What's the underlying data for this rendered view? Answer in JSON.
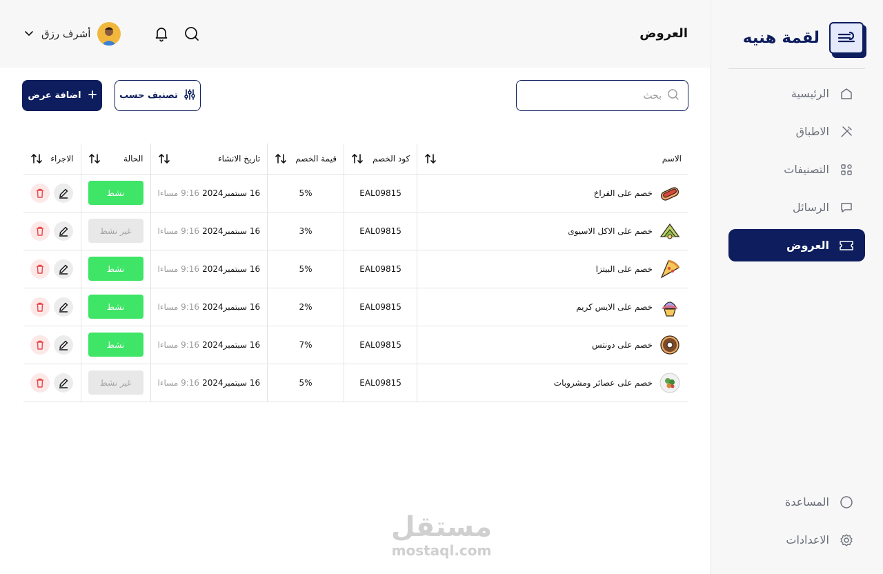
{
  "brand": {
    "name": "لقمة هنيه"
  },
  "sidebar": {
    "items": [
      {
        "label": "الرئيسية",
        "icon": "home-icon",
        "active": false
      },
      {
        "label": "الاطباق",
        "icon": "dishes-icon",
        "active": false
      },
      {
        "label": "التصنيفات",
        "icon": "categories-icon",
        "active": false
      },
      {
        "label": "الرسائل",
        "icon": "messages-icon",
        "active": false
      },
      {
        "label": "العروض",
        "icon": "offers-icon",
        "active": true
      }
    ],
    "bottom": [
      {
        "label": "المساعدة",
        "icon": "help-icon"
      },
      {
        "label": "الاعدادات",
        "icon": "settings-icon"
      }
    ]
  },
  "header": {
    "title": "العروض",
    "user_name": "أشرف رزق"
  },
  "toolbar": {
    "search_placeholder": "بحث",
    "sort_label": "تصنيف حسب",
    "add_label": "اضافة عرض"
  },
  "table": {
    "columns": {
      "name": "الاسم",
      "code": "كود الخصم",
      "discount": "قيمة الخصم",
      "date": "تاريخ الانشاء",
      "status": "الحالة",
      "actions": "الاجراء"
    },
    "rows": [
      {
        "name": "خصم على الفراخ",
        "code": "EAL09815",
        "discount": "5%",
        "date": "16 سبتمبر2024",
        "time": "9:16 مساءا",
        "status": "نشط",
        "active": true,
        "icon": "hotdog-icon"
      },
      {
        "name": "خصم على الاكل الاسيوى",
        "code": "EAL09815",
        "discount": "3%",
        "date": "16 سبتمبر2024",
        "time": "9:16 مساءا",
        "status": "غير نشط",
        "active": false,
        "icon": "dumpling-icon"
      },
      {
        "name": "خصم على البيتزا",
        "code": "EAL09815",
        "discount": "5%",
        "date": "16 سبتمبر2024",
        "time": "9:16 مساءا",
        "status": "نشط",
        "active": true,
        "icon": "pizza-icon"
      },
      {
        "name": "خصم على الايس كريم",
        "code": "EAL09815",
        "discount": "2%",
        "date": "16 سبتمبر2024",
        "time": "9:16 مساءا",
        "status": "نشط",
        "active": true,
        "icon": "icecream-icon"
      },
      {
        "name": "خصم على دونتس",
        "code": "EAL09815",
        "discount": "7%",
        "date": "16 سبتمبر2024",
        "time": "9:16 مساءا",
        "status": "نشط",
        "active": true,
        "icon": "donut-icon"
      },
      {
        "name": "خصم على عصائر ومشروبات",
        "code": "EAL09815",
        "discount": "5%",
        "date": "16 سبتمبر2024",
        "time": "9:16 مساءا",
        "status": "غير نشط",
        "active": false,
        "icon": "salad-icon"
      }
    ]
  },
  "watermark": {
    "arabic": "مستقل",
    "latin": "mostaql.com"
  },
  "colors": {
    "primary": "#0d1d5e",
    "active": "#3ee566",
    "inactive": "#e8e8e8",
    "danger": "#e5484d"
  }
}
